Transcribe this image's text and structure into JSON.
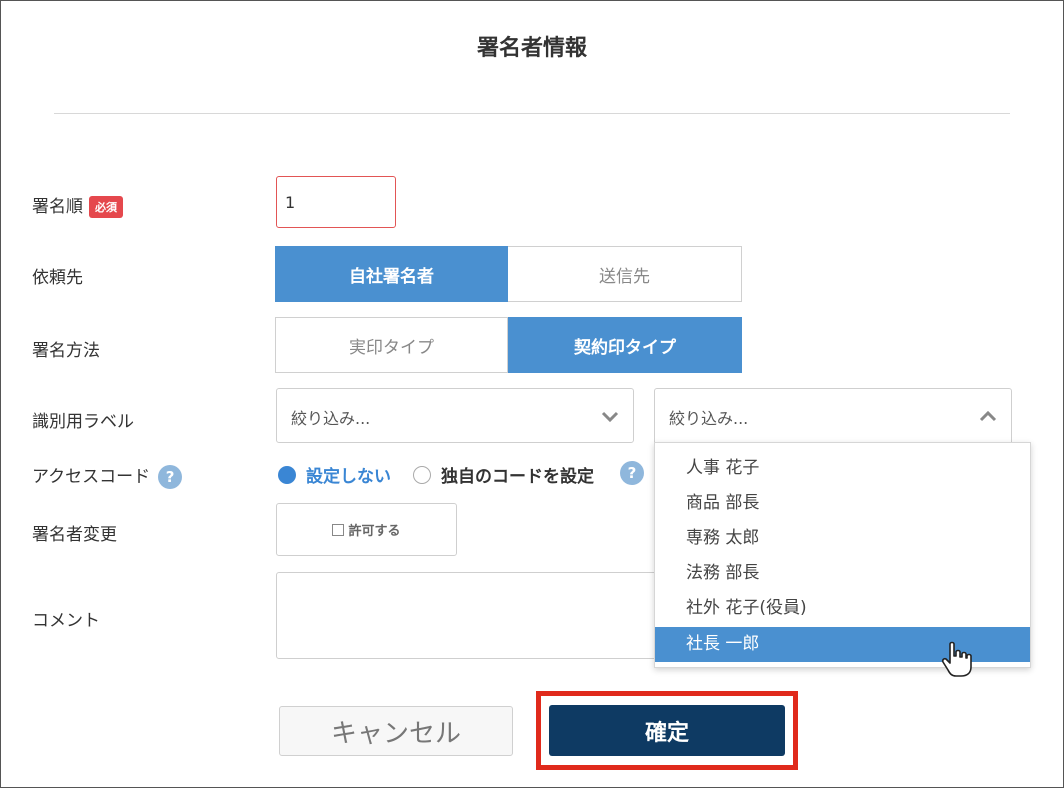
{
  "dialog": {
    "title": "署名者情報"
  },
  "form": {
    "order_label": "署名順",
    "required_badge": "必須",
    "order_value": "1",
    "request_label": "依頼先",
    "request_options": [
      "自社署名者",
      "送信先"
    ],
    "request_selected": "自社署名者",
    "method_label": "署名方法",
    "method_options": [
      "実印タイプ",
      "契約印タイプ"
    ],
    "method_selected": "契約印タイプ",
    "id_label_label": "識別用ラベル",
    "filter_placeholder_left": "絞り込み...",
    "filter_placeholder_right": "絞り込み...",
    "access_label": "アクセスコード",
    "help_glyph": "?",
    "access_options": [
      "設定しない",
      "独自のコードを設定"
    ],
    "access_selected": "設定しない",
    "change_label": "署名者変更",
    "permit_label": "許可する",
    "comment_label": "コメント"
  },
  "dropdown": {
    "items": [
      "人事 花子",
      "商品 部長",
      "専務 太郎",
      "法務 部長",
      "社外 花子(役員)",
      "社長 一郎"
    ],
    "highlighted": "社長 一郎"
  },
  "buttons": {
    "cancel": "キャンセル",
    "confirm": "確定"
  },
  "colors": {
    "primary": "#4a90d0",
    "confirm": "#0e3a63",
    "required": "#e5484d",
    "highlight_frame": "#e02a1c"
  }
}
